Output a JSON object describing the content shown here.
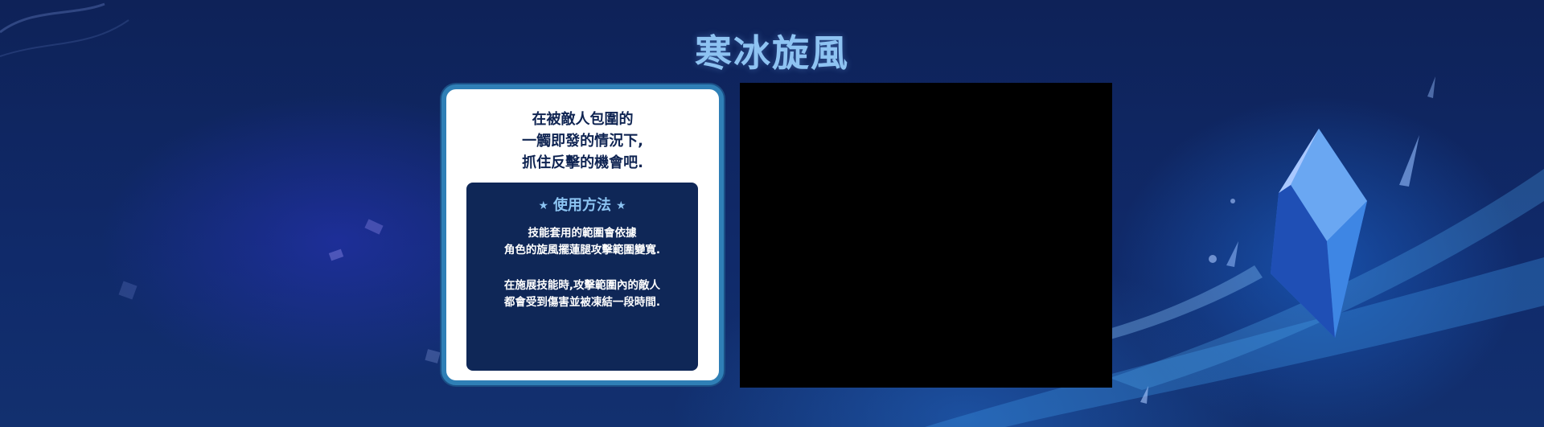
{
  "page": {
    "title": "寒冰旋風"
  },
  "info_card": {
    "tagline": [
      "在被敵人包圍的",
      "一觸即發的情況下,",
      "抓住反擊的機會吧."
    ],
    "usage": {
      "heading": "使用方法",
      "star_icon": "★",
      "paragraph_1": [
        "技能套用的範圍會依據",
        "角色的旋風擺蓮腿攻擊範圍變寬."
      ],
      "paragraph_2": [
        "在施展技能時,攻擊範圍內的敵人",
        "都會受到傷害並被凍結一段時間."
      ]
    }
  },
  "colors": {
    "background": "#0e2258",
    "title": "#8ec3f2",
    "card_border": "#2f7fb6",
    "usage_panel": "#0f2757",
    "video": "#000000"
  }
}
